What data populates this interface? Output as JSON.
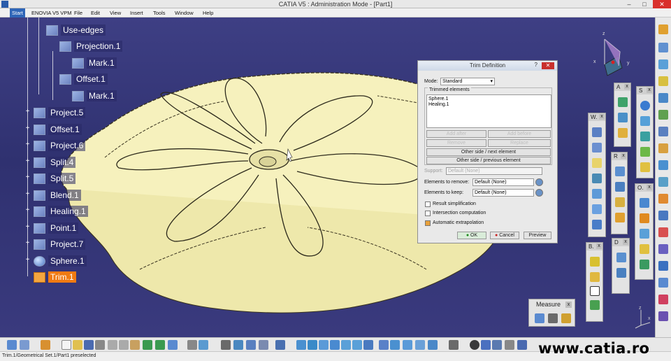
{
  "window": {
    "title": "CATIA V5 : Administration Mode - [Part1]",
    "min": "–",
    "max": "□",
    "close": "✕"
  },
  "menubar": {
    "start": "Start",
    "items": [
      "ENOVIA V5 VPM",
      "File",
      "Edit",
      "View",
      "Insert",
      "Tools",
      "Window",
      "Help"
    ]
  },
  "tree": {
    "items": [
      {
        "label": "Use-edges",
        "icon": "use-edges-icon"
      },
      {
        "label": "Projection.1",
        "icon": "projection-icon"
      },
      {
        "label": "Mark.1",
        "icon": "mark-icon"
      },
      {
        "label": "Offset.1",
        "icon": "offset-icon"
      },
      {
        "label": "Mark.1",
        "icon": "mark-icon"
      },
      {
        "label": "Project.5",
        "icon": "project-icon"
      },
      {
        "label": "Offset.1",
        "icon": "offset-icon"
      },
      {
        "label": "Project.6",
        "icon": "project-icon"
      },
      {
        "label": "Split.4",
        "icon": "split-icon"
      },
      {
        "label": "Split.5",
        "icon": "split-icon"
      },
      {
        "label": "Blend.1",
        "icon": "blend-icon"
      },
      {
        "label": "Healing.1",
        "icon": "healing-icon"
      },
      {
        "label": "Point.1",
        "icon": "point-icon"
      },
      {
        "label": "Project.7",
        "icon": "project-icon"
      },
      {
        "label": "Sphere.1",
        "icon": "sphere-icon"
      },
      {
        "label": "Trim.1",
        "icon": "trim-icon",
        "selected": true
      }
    ]
  },
  "trim_dialog": {
    "title": "Trim Definition",
    "help": "?",
    "close": "✕",
    "mode_label": "Mode:",
    "mode_value": "Standard",
    "trimmed_label": "Trimmed elements",
    "trimmed_items": [
      "Sphere.1",
      "Healing.1"
    ],
    "add_after": "Add after",
    "add_before": "Add before",
    "remove": "Remove",
    "replace": "Replace",
    "other_side_next": "Other side / next element",
    "other_side_prev": "Other side / previous element",
    "support_label": "Support:",
    "support_value": "Default (None)",
    "remove_label": "Elements to remove:",
    "remove_value": "Default (None)",
    "keep_label": "Elements to keep:",
    "keep_value": "Default (None)",
    "result_simplification": {
      "label": "Result simplification",
      "checked": false
    },
    "intersection_computation": {
      "label": "Intersection computation",
      "checked": false
    },
    "automatic_extrapolation": {
      "label": "Automatic extrapolation",
      "checked": true
    },
    "ok": "OK",
    "cancel": "Cancel",
    "preview": "Preview"
  },
  "toolboxes": {
    "w": "W.",
    "a": "A",
    "s": "S",
    "r": "R",
    "o": "O.",
    "b": "B.",
    "d": "D",
    "close": "x"
  },
  "measure": {
    "title": "Measure",
    "close": "x"
  },
  "compass": {
    "z": "z",
    "x": "x",
    "y": "y"
  },
  "axis": {
    "z": "z",
    "x": "x"
  },
  "status": {
    "text": "Trim.1/Geometrical Set.1/Part1 preselected"
  },
  "watermark": "www.catia.ro"
}
